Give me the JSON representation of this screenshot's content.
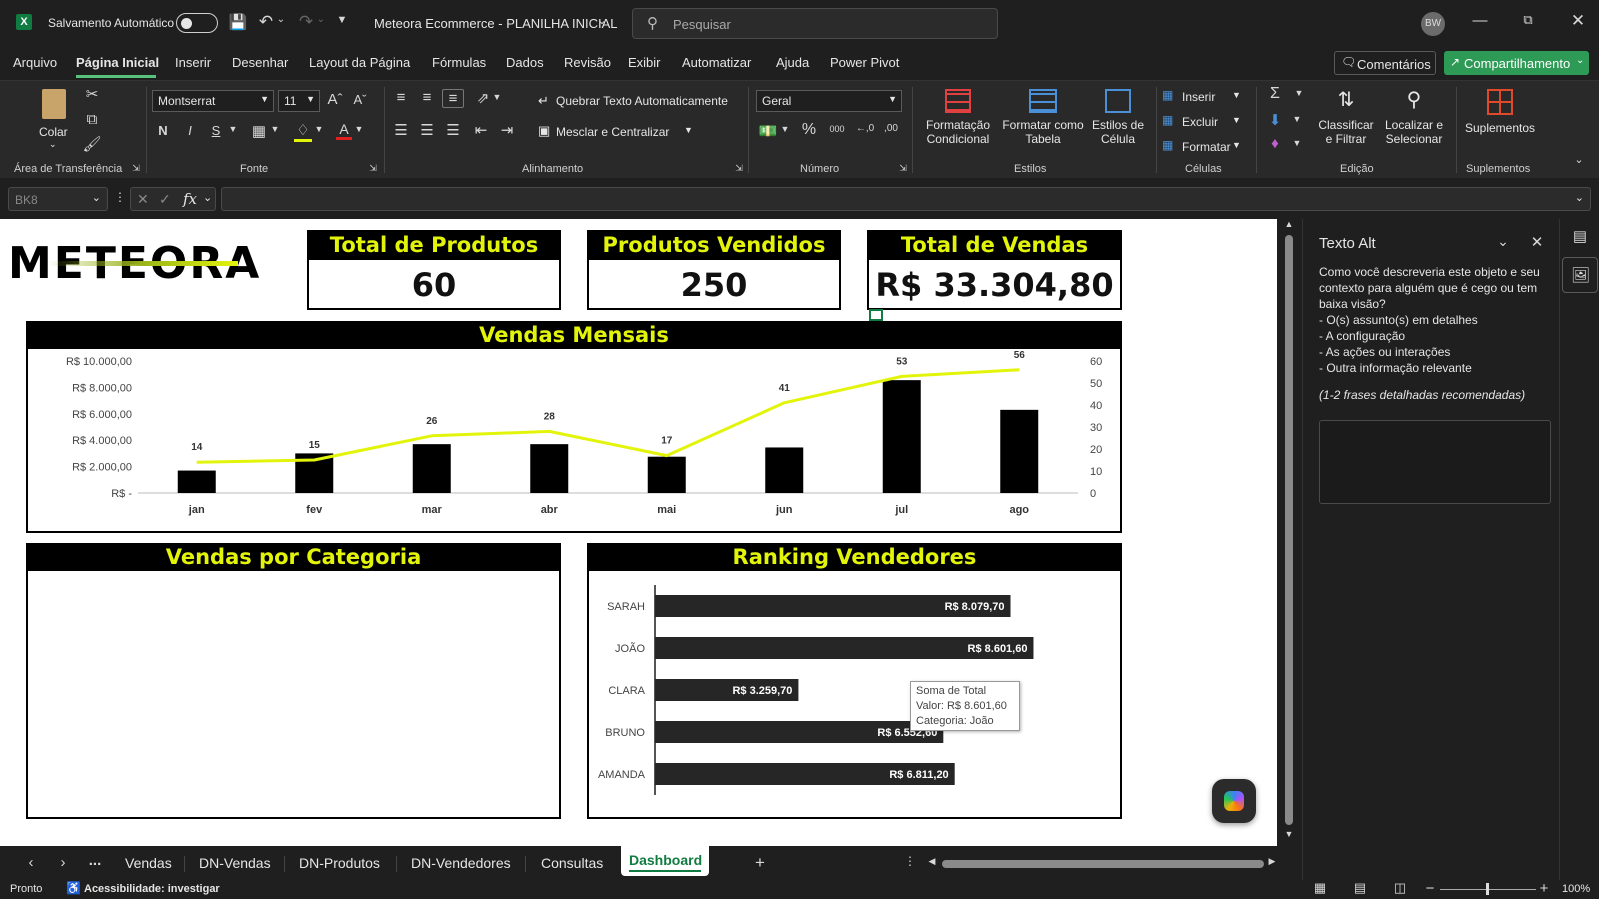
{
  "titlebar": {
    "autosave_label": "Salvamento Automático",
    "doc_title": "Meteora Ecommerce - PLANILHA INICIAL",
    "search_placeholder": "Pesquisar",
    "user_initials": "BW"
  },
  "menu": {
    "items": [
      "Arquivo",
      "Página Inicial",
      "Inserir",
      "Desenhar",
      "Layout da Página",
      "Fórmulas",
      "Dados",
      "Revisão",
      "Exibir",
      "Automatizar",
      "Ajuda",
      "Power Pivot"
    ],
    "active": "Página Inicial",
    "comments_label": "Comentários",
    "share_label": "Compartilhamento"
  },
  "ribbon": {
    "paste_label": "Colar",
    "clipboard_group": "Área de Transferência",
    "font_name": "Montserrat",
    "font_size": "11",
    "font_group": "Fonte",
    "wrap_text": "Quebrar Texto Automaticamente",
    "merge_center": "Mesclar e Centralizar",
    "alignment_group": "Alinhamento",
    "number_format": "Geral",
    "number_group": "Número",
    "cond_format_1": "Formatação",
    "cond_format_2": "Condicional",
    "format_table_1": "Formatar como",
    "format_table_2": "Tabela",
    "cell_styles_1": "Estilos de",
    "cell_styles_2": "Célula",
    "styles_group": "Estilos",
    "insert": "Inserir",
    "delete": "Excluir",
    "format": "Formatar",
    "cells_group": "Células",
    "sort_filter_1": "Classificar",
    "sort_filter_2": "e Filtrar",
    "find_select_1": "Localizar e",
    "find_select_2": "Selecionar",
    "editing_group": "Edição",
    "addins": "Suplementos",
    "addins_group": "Suplementos"
  },
  "formula_bar": {
    "name_box": "BK8",
    "fx": "fx"
  },
  "dashboard": {
    "logo_text": "METEORA",
    "kpis": [
      {
        "title": "Total de Produtos",
        "value": "60"
      },
      {
        "title": "Produtos Vendidos",
        "value": "250"
      },
      {
        "title": "Total de Vendas",
        "value": "R$ 33.304,80"
      }
    ],
    "monthly_title": "Vendas Mensais",
    "category_title": "Vendas por Categoria",
    "ranking_title": "Ranking Vendedores",
    "tooltip": {
      "line1": "Soma de Total",
      "line2": "Valor:  R$ 8.601,60",
      "line3": "Categoria: João"
    }
  },
  "chart_data": [
    {
      "type": "bar",
      "title": "Vendas Mensais",
      "categories": [
        "jan",
        "fev",
        "mar",
        "abr",
        "mai",
        "jun",
        "jul",
        "ago"
      ],
      "y_ticks": [
        "R$ 10.000,00",
        "R$ 8.000,00",
        "R$ 6.000,00",
        "R$ 4.000,00",
        "R$ 2.000,00",
        "R$ -"
      ],
      "ylim": [
        0,
        10000
      ],
      "y2_ticks": [
        "60",
        "50",
        "40",
        "30",
        "20",
        "10",
        "0"
      ],
      "y2lim": [
        0,
        60
      ],
      "series": [
        {
          "values": [
            1700,
            3000,
            3700,
            3700,
            2750,
            3450,
            8550,
            6300
          ],
          "type": "bar",
          "color": "#000000"
        },
        {
          "values": [
            14,
            15,
            26,
            28,
            17,
            41,
            53,
            56
          ],
          "type": "line",
          "axis": "secondary",
          "color": "#e3f40b",
          "labels": [
            "14",
            "15",
            "26",
            "28",
            "17",
            "41",
            "53",
            "56"
          ]
        }
      ],
      "grid": false
    },
    {
      "type": "bar",
      "orientation": "horizontal",
      "title": "Ranking Vendedores",
      "categories": [
        "SARAH",
        "JOÃO",
        "CLARA",
        "BRUNO",
        "AMANDA"
      ],
      "values": [
        8079.7,
        8601.6,
        3259.7,
        6552.6,
        6811.2
      ],
      "labels": [
        "R$ 8.079,70",
        "R$ 8.601,60",
        "R$ 3.259,70",
        "R$ 6.552,60",
        "R$ 6.811,20"
      ],
      "xlim": [
        0,
        10000
      ],
      "color": "#262626"
    }
  ],
  "alt_text_panel": {
    "title": "Texto Alt",
    "description": "Como você descreveria este objeto e seu contexto para alguém que é cego ou tem baixa visão?",
    "bullets": [
      "- O(s) assunto(s) em detalhes",
      "- A configuração",
      "- As ações ou interações",
      "- Outra informação relevante"
    ],
    "hint": "(1-2 frases detalhadas recomendadas)"
  },
  "sheet_tabs": {
    "tabs": [
      "Vendas",
      "DN-Vendas",
      "DN-Produtos",
      "DN-Vendedores",
      "Consultas",
      "Dashboard"
    ],
    "active": "Dashboard",
    "more": "..."
  },
  "status": {
    "ready": "Pronto",
    "accessibility": "Acessibilidade: investigar",
    "zoom": "100%"
  }
}
